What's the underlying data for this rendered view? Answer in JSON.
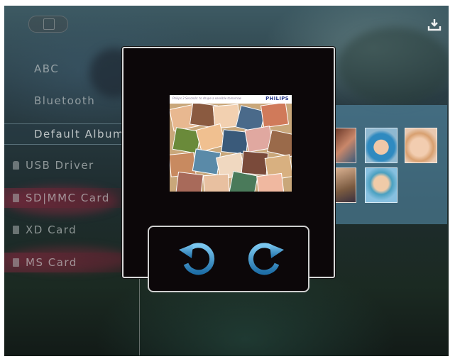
{
  "menu": {
    "albums": [
      {
        "label": "ABC"
      },
      {
        "label": "Bluetooth"
      },
      {
        "label": "Default Album"
      }
    ],
    "devices": [
      {
        "label": "USB Driver"
      },
      {
        "label": "SD|MMC Card"
      },
      {
        "label": "XD Card"
      },
      {
        "label": "MS Card"
      }
    ],
    "selected": "Default Album"
  },
  "preview": {
    "brand": "PHILIPS",
    "tagline": "Philips 3 Seconds: to shape a sensible tomorrow"
  },
  "icons": {
    "top_left": "album-tab-icon",
    "top_right": "download-icon",
    "rotate_left": "rotate-counterclockwise-icon",
    "rotate_right": "rotate-clockwise-icon"
  },
  "colors": {
    "dialog_bg": "#0c0709",
    "accent": "#2f89c8",
    "selection_band": "#2b4652"
  }
}
